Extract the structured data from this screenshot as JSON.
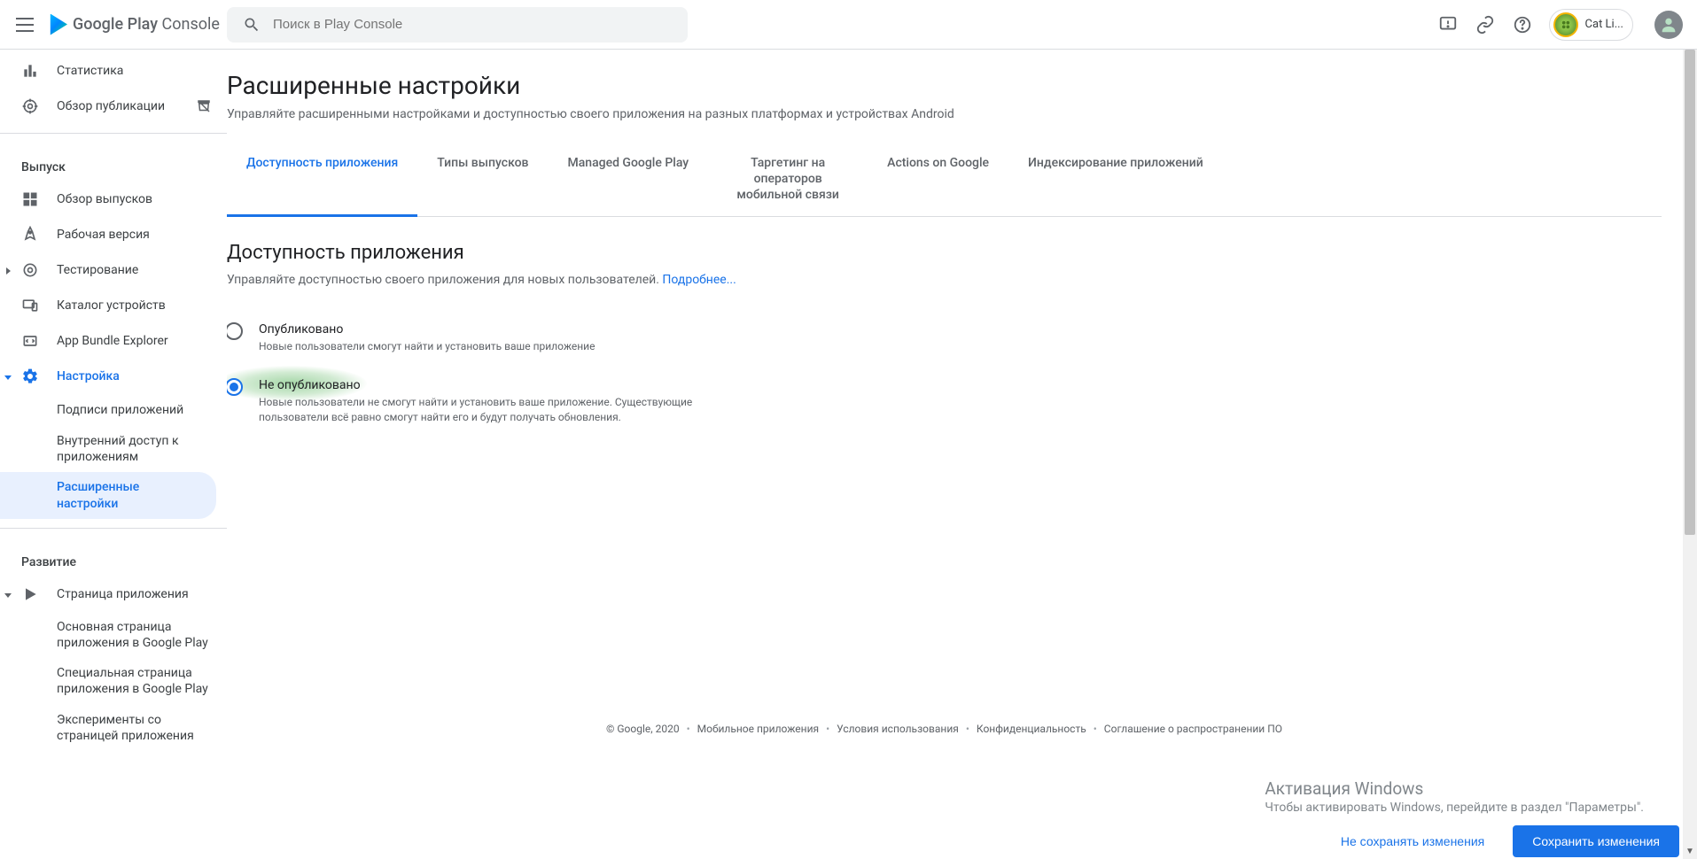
{
  "header": {
    "logo_text_bold": "Google Play",
    "logo_text_light": " Console",
    "search_placeholder": "Поиск в Play Console",
    "user_name": "Cat Li..."
  },
  "sidebar": {
    "top": [
      {
        "icon": "stats",
        "label": "Статистика"
      },
      {
        "icon": "publish-overview",
        "label": "Обзор публикации",
        "rightIcon": "unpublish"
      }
    ],
    "section1": "Выпуск",
    "release": [
      {
        "icon": "dashboard",
        "label": "Обзор выпусков"
      },
      {
        "icon": "rocket",
        "label": "Рабочая версия"
      },
      {
        "icon": "test",
        "label": "Тестирование",
        "caret": "right"
      },
      {
        "icon": "devices",
        "label": "Каталог устройств"
      },
      {
        "icon": "bundle",
        "label": "App Bundle Explorer"
      },
      {
        "icon": "gear",
        "label": "Настройка",
        "caret": "down",
        "activeParent": true
      }
    ],
    "release_sub": [
      {
        "label": "Подписи приложений"
      },
      {
        "label": "Внутренний доступ к приложениям"
      },
      {
        "label": "Расширенные настройки",
        "active": true
      }
    ],
    "section2": "Развитие",
    "grow": [
      {
        "icon": "play",
        "label": "Страница приложения",
        "caret": "down"
      }
    ],
    "grow_sub": [
      {
        "label": "Основная страница приложения в Google Play"
      },
      {
        "label": "Специальная страница приложения в Google Play"
      },
      {
        "label": "Эксперименты со страницей приложения"
      }
    ]
  },
  "page": {
    "title": "Расширенные настройки",
    "subtitle": "Управляйте расширенными настройками и доступностью своего приложения на разных платформах и устройствах Android",
    "tabs": [
      "Доступность приложения",
      "Типы выпусков",
      "Managed Google Play",
      "Таргетинг на операторов мобильной связи",
      "Actions on Google",
      "Индексирование приложений"
    ],
    "active_tab": 0,
    "section_title": "Доступность приложения",
    "section_desc": "Управляйте доступностью своего приложения для новых пользователей. ",
    "section_link": "Подробнее...",
    "radios": [
      {
        "label": "Опубликовано",
        "desc": "Новые пользователи смогут найти и установить ваше приложение"
      },
      {
        "label": "Не опубликовано",
        "desc": "Новые пользователи не смогут найти и установить ваше приложение. Существующие пользователи всё равно смогут найти его и будут получать обновления."
      }
    ],
    "selected_radio": 1
  },
  "footer": {
    "items": [
      "© Google, 2020",
      "Мобильное приложения",
      "Условия использования",
      "Конфиденциальность",
      "Соглашение о распространении ПО"
    ]
  },
  "watermark": {
    "title": "Активация Windows",
    "desc": "Чтобы активировать Windows, перейдите в раздел \"Параметры\"."
  },
  "actions": {
    "discard": "Не сохранять изменения",
    "save": "Сохранить изменения"
  }
}
